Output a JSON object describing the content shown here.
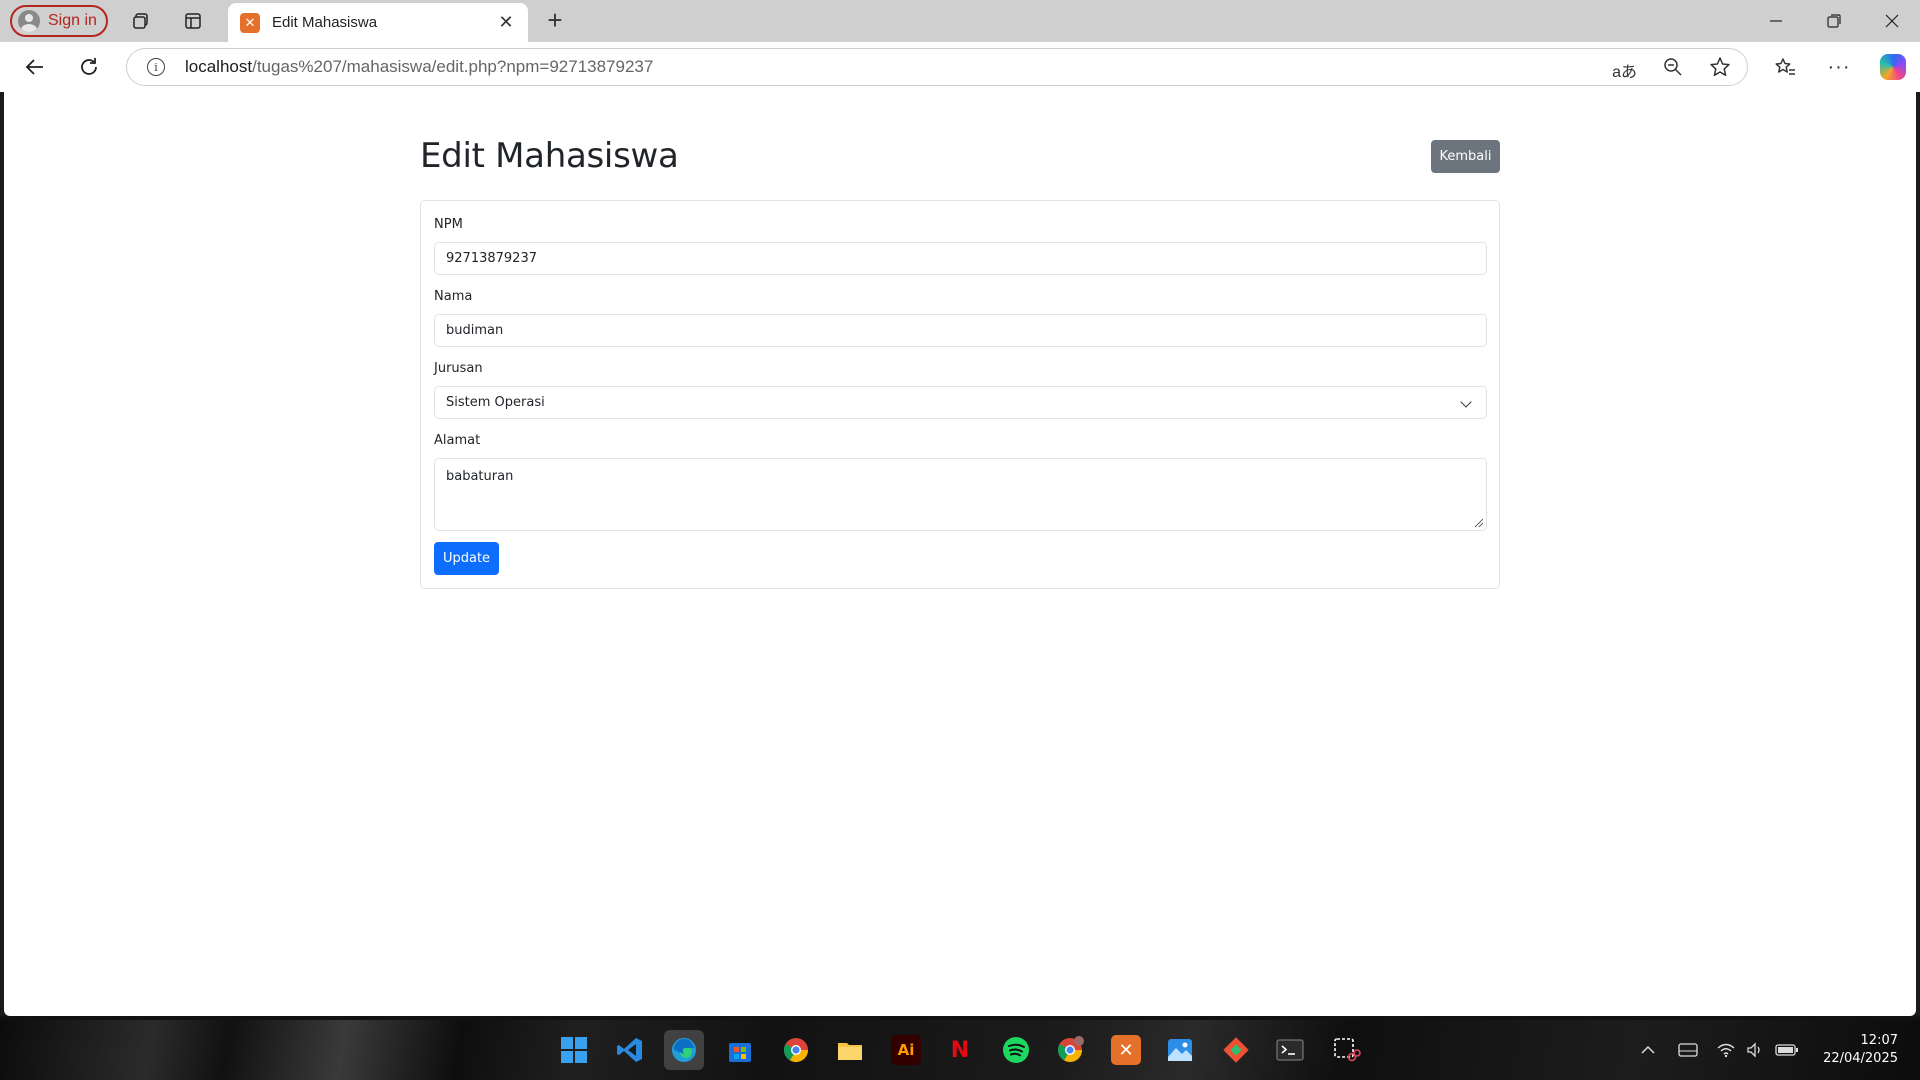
{
  "browser": {
    "signin_label": "Sign in",
    "tab_title": "Edit Mahasiswa",
    "url_host": "localhost",
    "url_path": "/tugas%207/mahasiswa/edit.php?npm=92713879237"
  },
  "page": {
    "title": "Edit Mahasiswa",
    "back_button": "Kembali",
    "fields": {
      "npm": {
        "label": "NPM",
        "value": "92713879237"
      },
      "nama": {
        "label": "Nama",
        "value": "budiman"
      },
      "jurusan": {
        "label": "Jurusan",
        "value": "Sistem Operasi"
      },
      "alamat": {
        "label": "Alamat",
        "value": "babaturan"
      }
    },
    "submit_button": "Update"
  },
  "taskbar": {
    "time": "12:07",
    "date": "22/04/2025",
    "icons": [
      "windows-start",
      "vscode",
      "edge",
      "microsoft-store",
      "chrome",
      "file-explorer",
      "illustrator",
      "netflix",
      "spotify",
      "chrome-profile",
      "xampp",
      "photos",
      "git",
      "terminal",
      "snipping-tool"
    ]
  },
  "colors": {
    "primary": "#0d6efd",
    "secondary": "#6c757d",
    "signin_accent": "#b3261e",
    "xampp_orange": "#e5702a"
  }
}
